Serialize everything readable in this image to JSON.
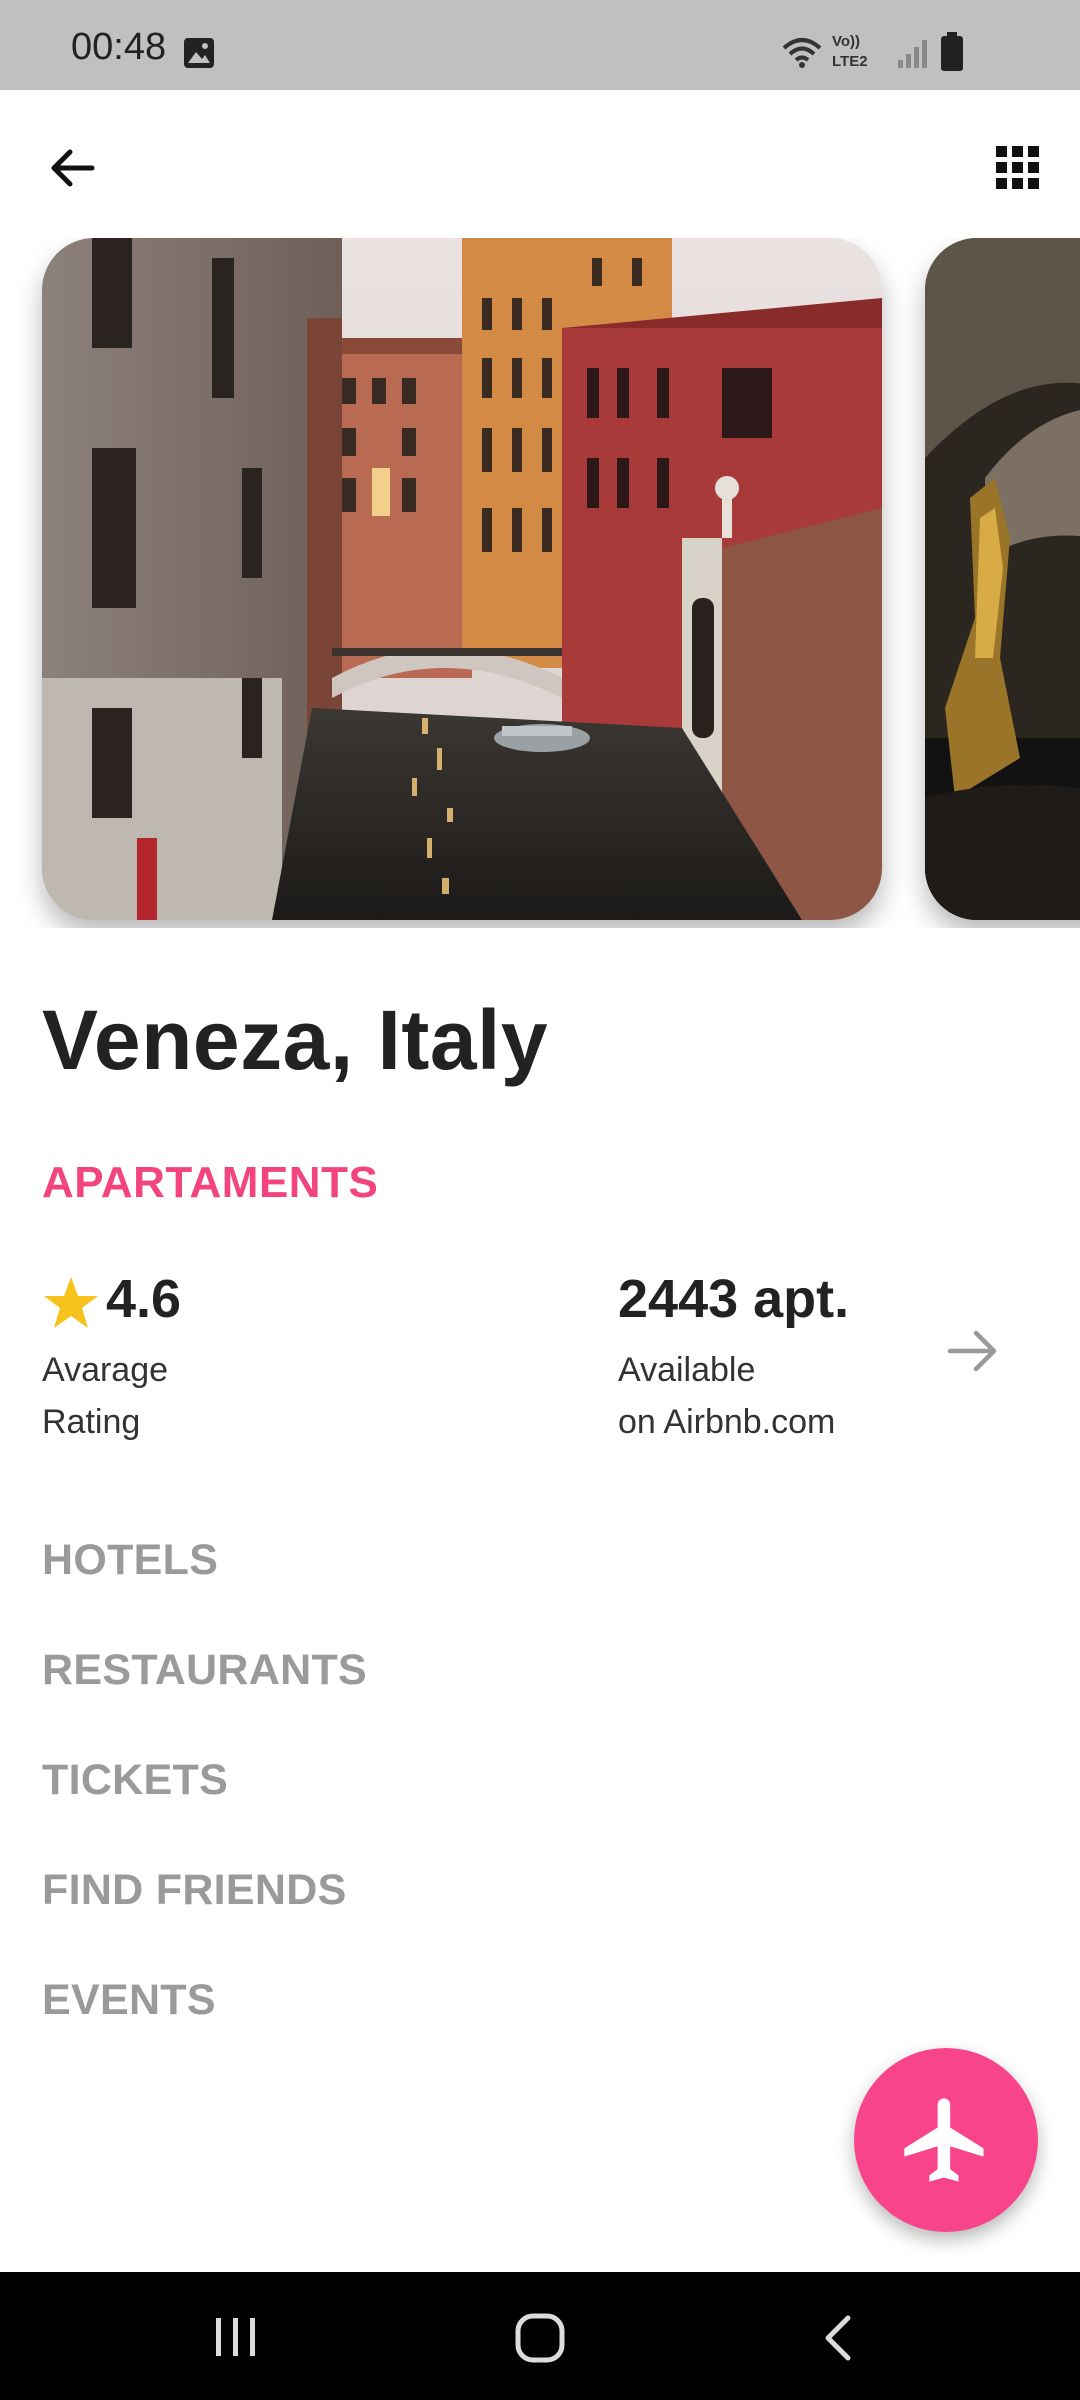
{
  "status_bar": {
    "time": "00:48",
    "network_label": "Vo)) LTE2"
  },
  "app_bar": {
    "back_icon": "arrow-left-icon",
    "menu_icon": "grid-icon"
  },
  "carousel": {
    "images": [
      "venice-canal-photo",
      "venice-gondola-photo"
    ]
  },
  "destination": {
    "title": "Veneza, Italy"
  },
  "active_section": "APARTAMENTS",
  "stats": {
    "rating_value": "4.6",
    "rating_label_line1": "Avarage",
    "rating_label_line2": "Rating",
    "apartments_value": "2443 apt.",
    "apartments_label_line1": "Available",
    "apartments_label_line2": "on Airbnb.com"
  },
  "menu": [
    "HOTELS",
    "RESTAURANTS",
    "TICKETS",
    "FIND FRIENDS",
    "EVENTS"
  ],
  "fab": {
    "icon": "airplane-icon"
  },
  "colors": {
    "accent": "#f2457f",
    "fab": "#f7448a",
    "muted": "#9a9a9a",
    "star": "#f7c21b"
  }
}
